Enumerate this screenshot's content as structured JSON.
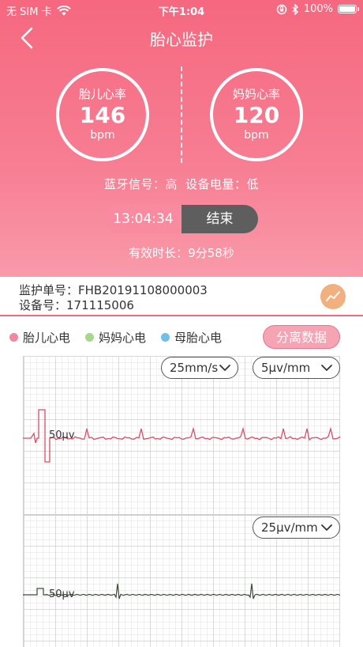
{
  "status_bar": {
    "carrier": "无 SIM 卡",
    "time": "下午1:04",
    "battery": "100%"
  },
  "nav": {
    "title": "胎心监护"
  },
  "fetal_hr": {
    "label": "胎儿心率",
    "value": "146",
    "unit": "bpm"
  },
  "maternal_hr": {
    "label": "妈妈心率",
    "value": "120",
    "unit": "bpm"
  },
  "signal": {
    "bluetooth_label": "蓝牙信号：",
    "bluetooth_value": "高",
    "battery_label": "设备电量：",
    "battery_value": "低"
  },
  "session": {
    "timer": "13:04:34",
    "end_label": "结束",
    "valid_label": "有效时长：",
    "valid_value": "9分58秒"
  },
  "info": {
    "order_label": "监护单号：",
    "order_value": "FHB20191108000003",
    "device_label": "设备号：",
    "device_value": "171115006"
  },
  "legend": {
    "items": [
      {
        "label": "胎儿心电",
        "color": "#f0899e"
      },
      {
        "label": "妈妈心电",
        "color": "#a7d68d"
      },
      {
        "label": "母胎心电",
        "color": "#6fbfe8"
      }
    ],
    "separate_button": "分离数据"
  },
  "chart_top": {
    "speed": "25mm/s",
    "gain": "5μv/mm",
    "calibration_label": "50μv",
    "line_color": "#d94f6a"
  },
  "chart_bottom": {
    "gain": "25μv/mm",
    "calibration_label": "50μv",
    "line_color": "#3d4a3a"
  },
  "colors": {
    "accent": "#f5687f",
    "button_dark": "#5e5e5e",
    "trend_button": "#f3b07f"
  }
}
